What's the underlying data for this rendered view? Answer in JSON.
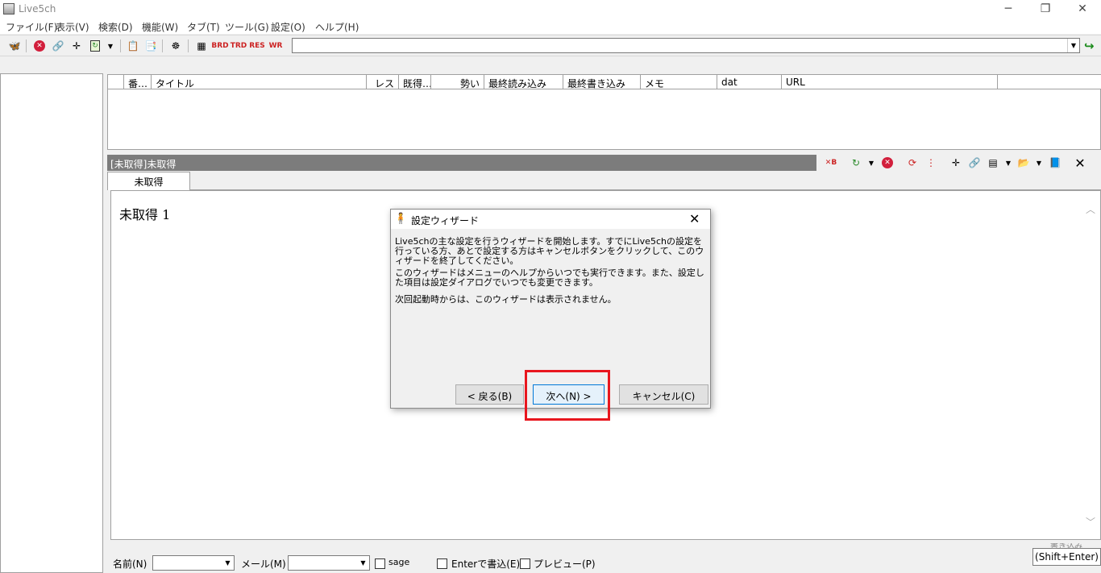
{
  "window": {
    "title": "Live5ch"
  },
  "menu": [
    "ファイル(F)",
    "表示(V)",
    "検索(D)",
    "機能(W)",
    "タブ(T)",
    "ツール(G)",
    "設定(O)",
    "ヘルプ(H)"
  ],
  "list": {
    "columns": [
      "番…",
      "タイトル",
      "レス",
      "既得…",
      "勢い",
      "最終読み込み",
      "最終書き込み",
      "メモ",
      "dat",
      "URL"
    ]
  },
  "thread": {
    "title_bar": "[未取得]未取得",
    "tab_label": "未取得",
    "body_text": "未取得 1"
  },
  "post_form": {
    "name_label": "名前(N)",
    "mail_label": "メール(M)",
    "sage_label": "sage",
    "enter_label": "Enterで書込(E)",
    "preview_label": "プレビュー(P)",
    "submit_label": "(Shift+Enter)",
    "submit_label_above": "書き込み"
  },
  "dialog": {
    "title": "設定ウィザード",
    "para1": "Live5chの主な設定を行うウィザードを開始します。すでにLive5chの設定を行っている方、あとで設定する方はキャンセルボタンをクリックして、このウィザードを終了してください。",
    "para2": "このウィザードはメニューのヘルプからいつでも実行できます。また、設定した項目は設定ダイアログでいつでも変更できます。",
    "para3": "次回起動時からは、このウィザードは表示されません。",
    "back_button": "< 戻る(B)",
    "next_button": "次へ(N) >",
    "cancel_button": "キャンセル(C)"
  },
  "highlight_color": "#e8161e"
}
